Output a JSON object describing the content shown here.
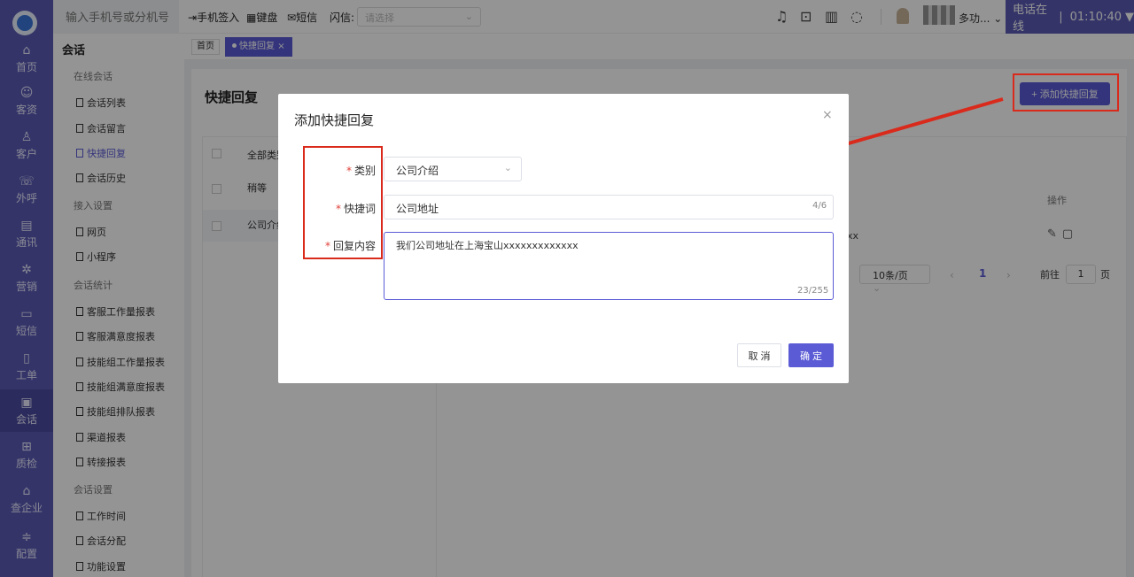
{
  "leftnav": {
    "items": [
      {
        "label": "首页",
        "icon": "home-icon"
      },
      {
        "label": "客资",
        "icon": "leads-icon"
      },
      {
        "label": "客户",
        "icon": "customer-icon"
      },
      {
        "label": "外呼",
        "icon": "outbound-call-icon"
      },
      {
        "label": "通讯",
        "icon": "contacts-icon"
      },
      {
        "label": "营销",
        "icon": "marketing-icon"
      },
      {
        "label": "短信",
        "icon": "sms-icon"
      },
      {
        "label": "工单",
        "icon": "ticket-icon"
      },
      {
        "label": "会话",
        "icon": "chat-icon"
      },
      {
        "label": "质检",
        "icon": "quality-icon"
      },
      {
        "label": "查企业",
        "icon": "company-search-icon"
      },
      {
        "label": "配置",
        "icon": "settings-icon"
      }
    ],
    "active_index": 8
  },
  "topbar": {
    "phone_placeholder": "输入手机号或分机号",
    "mobile_checkin": "手机签入",
    "keypad": "键盘",
    "sms": "短信",
    "flash_label": "闪信:",
    "flash_placeholder": "请选择",
    "agent_name": "多功...",
    "phone_status": "电话在线",
    "timer": "01:10:40"
  },
  "submenu": {
    "title": "会话",
    "groups": [
      {
        "label": "在线会话",
        "items": [
          "会话列表",
          "会话留言",
          "快捷回复",
          "会话历史"
        ]
      },
      {
        "label": "接入设置",
        "items": [
          "网页",
          "小程序"
        ]
      },
      {
        "label": "会话统计",
        "items": [
          "客服工作量报表",
          "客服满意度报表",
          "技能组工作量报表",
          "技能组满意度报表",
          "技能组排队报表",
          "渠道报表",
          "转接报表"
        ]
      },
      {
        "label": "会话设置",
        "items": [
          "工作时间",
          "会话分配",
          "功能设置"
        ]
      }
    ],
    "active_item": "快捷回复"
  },
  "tabs": {
    "home": "首页",
    "active": "快捷回复",
    "active_close": "×"
  },
  "page": {
    "title": "快捷回复",
    "add_button": "+ 添加快捷回复",
    "categories": [
      {
        "label": "全部类别"
      },
      {
        "label": "稍等"
      },
      {
        "label": "公司介绍"
      }
    ],
    "op_header": "操作",
    "row_text": "xx",
    "row_icons": "✎ 🗑",
    "pager": {
      "page_size": "10条/页",
      "current": "1",
      "goto_label": "前往",
      "goto_value": "1",
      "page_unit": "页"
    }
  },
  "dialog": {
    "title": "添加快捷回复",
    "close": "×",
    "category_label": "类别",
    "category_value": "公司介绍",
    "keyword_label": "快捷词",
    "keyword_value": "公司地址",
    "keyword_count": "4/6",
    "reply_label": "回复内容",
    "reply_value": "我们公司地址在上海宝山xxxxxxxxxxxxx",
    "reply_count": "23/255",
    "cancel": "取 消",
    "confirm": "确 定"
  },
  "colors": {
    "brand": "#5b5bd6",
    "nav": "#5b5bb5",
    "annotation": "#d92a1c"
  }
}
